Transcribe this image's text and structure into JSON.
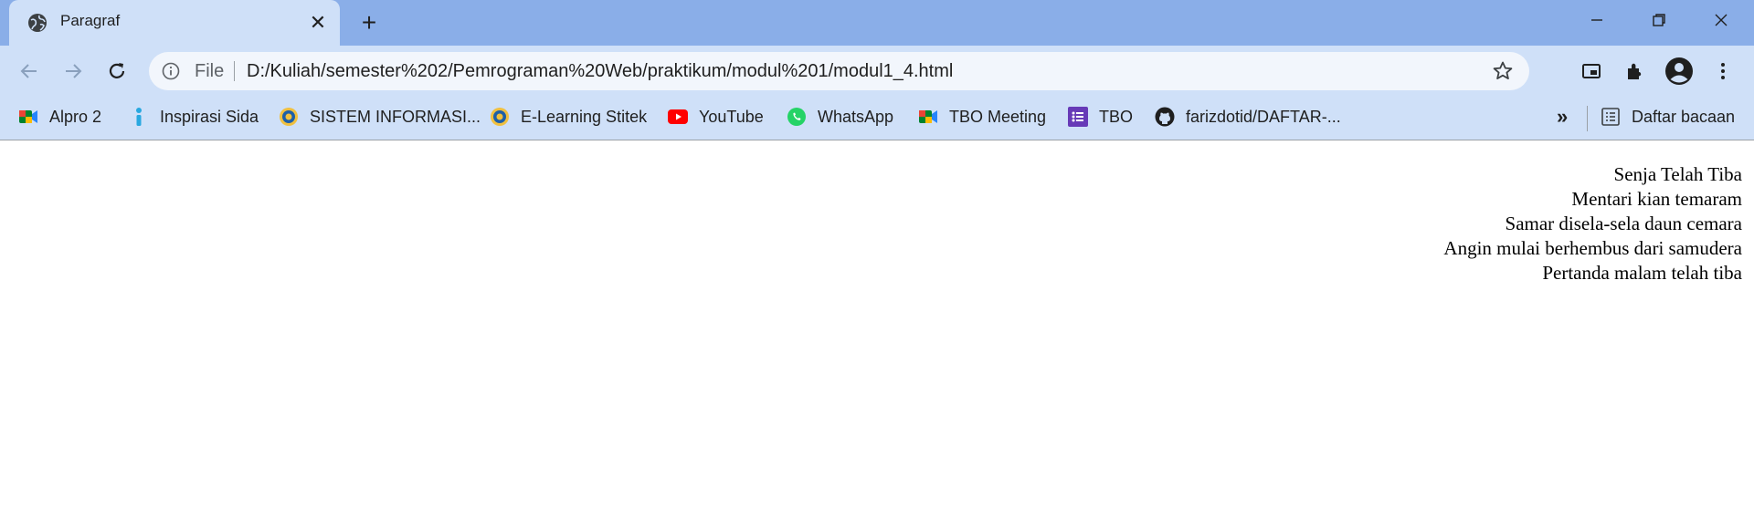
{
  "tab": {
    "title": "Paragraf",
    "favicon": "globe-icon",
    "close_icon": "close-icon"
  },
  "window_controls": [
    "minimize-icon",
    "restore-icon",
    "close-icon"
  ],
  "toolbar": {
    "back_icon": "arrow-left-icon",
    "forward_icon": "arrow-right-icon",
    "reload_icon": "reload-icon",
    "omnibox": {
      "scheme_label": "File",
      "url": "D:/Kuliah/semester%202/Pemrograman%20Web/praktikum/modul%201/modul1_4.html"
    },
    "right_icons": [
      "picture-in-picture-icon",
      "extensions-icon",
      "profile-icon",
      "menu-icon"
    ]
  },
  "bookmarks": {
    "items": [
      {
        "label": "Alpro 2",
        "icon": "google-meet-icon"
      },
      {
        "label": "Inspirasi Sida",
        "icon": "info-icon"
      },
      {
        "label": "SISTEM INFORMASI...",
        "icon": "university-logo-icon"
      },
      {
        "label": "E-Learning Stitek",
        "icon": "university-logo-icon"
      },
      {
        "label": "YouTube",
        "icon": "youtube-icon"
      },
      {
        "label": "WhatsApp",
        "icon": "whatsapp-icon"
      },
      {
        "label": "TBO Meeting",
        "icon": "google-meet-icon"
      },
      {
        "label": "TBO",
        "icon": "google-forms-icon"
      },
      {
        "label": "farizdotid/DAFTAR-...",
        "icon": "github-icon"
      }
    ],
    "overflow_label": "»",
    "reading_list_label": "Daftar bacaan"
  },
  "page": {
    "lines": [
      "Senja Telah Tiba",
      "Mentari kian temaram",
      "Samar disela-sela daun cemara",
      "Angin mulai berhembus dari samudera",
      "Pertanda malam telah tiba"
    ]
  },
  "colors": {
    "tabstrip": "#8aaee8",
    "toolbar": "#cfe0f8",
    "omnibox": "#f2f6fc",
    "text": "#1f1f1f"
  }
}
